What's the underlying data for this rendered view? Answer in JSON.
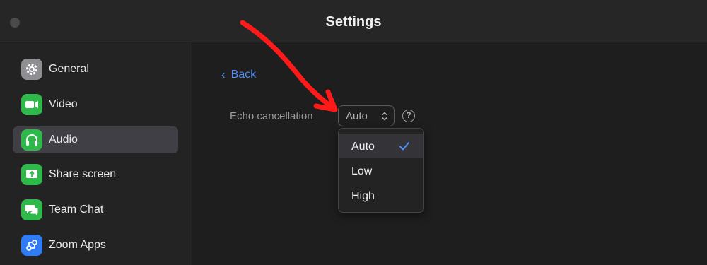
{
  "window": {
    "title": "Settings"
  },
  "sidebar": {
    "items": [
      {
        "label": "General",
        "icon": "gear-icon",
        "color": "#8e8e93"
      },
      {
        "label": "Video",
        "icon": "video-camera-icon",
        "color": "#30b94b"
      },
      {
        "label": "Audio",
        "icon": "headphones-icon",
        "color": "#30b94b",
        "active": true
      },
      {
        "label": "Share screen",
        "icon": "share-screen-icon",
        "color": "#30b94b"
      },
      {
        "label": "Team Chat",
        "icon": "chat-icon",
        "color": "#30b94b"
      },
      {
        "label": "Zoom Apps",
        "icon": "zoom-apps-icon",
        "color": "#2f7cf6"
      }
    ]
  },
  "content": {
    "back_label": "Back",
    "echo_cancellation": {
      "label": "Echo cancellation",
      "value": "Auto",
      "options": [
        "Auto",
        "Low",
        "High"
      ],
      "selected_option": "Auto"
    }
  },
  "colors": {
    "accent": "#4e8ef7",
    "annotation_arrow": "#ff1a1a"
  }
}
